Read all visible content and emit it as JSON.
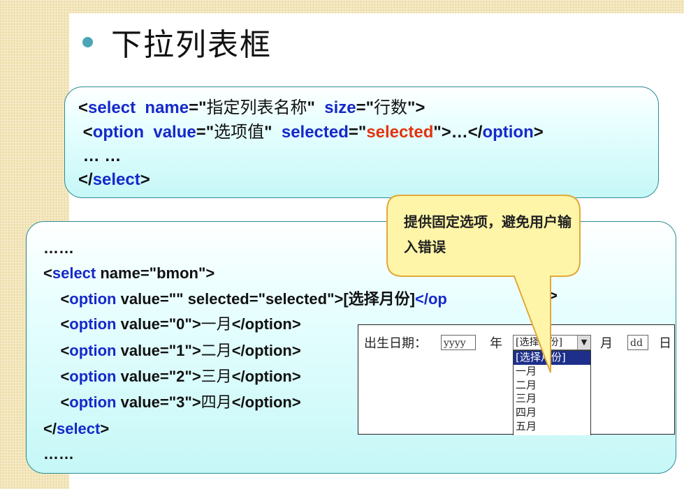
{
  "title": "下拉列表框",
  "syntax_box": {
    "l1": {
      "a": "<",
      "b": "select",
      "c": "  ",
      "d": "name",
      "e": "=\"",
      "f": "指定列表名称",
      "g": "\"  ",
      "h": "size",
      "i": "=\"",
      "j": "行数",
      "k": "\">"
    },
    "l2": {
      "a": " <",
      "b": "option",
      "c": "  ",
      "d": "value",
      "e": "=\"",
      "f": "选项值",
      "g": "\"  ",
      "h": "selected",
      "i": "=\"",
      "j": "selected",
      "k": "\">…</",
      "l": "option",
      "m": ">"
    },
    "l3": " … …",
    "l4": {
      "a": "</",
      "b": "select",
      "c": ">"
    }
  },
  "callout": {
    "text": "提供固定选项，避免用户输入错误"
  },
  "example_box": {
    "l1": "……",
    "l2": {
      "a": "<",
      "b": "select",
      "c": " name=\"bmon\">"
    },
    "l3": {
      "a": "    <",
      "b": "option",
      "c": " value=\"\" selected=\"selected\">",
      "d": "[选择月份]",
      "e": "</op"
    },
    "l3tail": ">",
    "l4": {
      "a": "    <",
      "b": "option",
      "c": " value=\"0\">",
      "d": "一月",
      "e": "</option>"
    },
    "l5": {
      "a": "    <",
      "b": "option",
      "c": " value=\"1\">",
      "d": "二月",
      "e": "</option>"
    },
    "l6": {
      "a": "    <",
      "b": "option",
      "c": " value=\"2\">",
      "d": "三月",
      "e": "</option>"
    },
    "l7": {
      "a": "    <",
      "b": "option",
      "c": " value=\"3\">",
      "d": "四月",
      "e": "</option>"
    },
    "l8": {
      "a": "</",
      "b": "select",
      "c": ">"
    },
    "l9": "……"
  },
  "form": {
    "birth_label": "出生日期：",
    "year_placeholder": "yyyy",
    "year_label": "年",
    "month_selected": "[选择月份]",
    "dropdown_arrow": "▼",
    "month_label": "月",
    "day_placeholder": "dd",
    "day_label": "日",
    "options": [
      "[选择月份]",
      "一月",
      "二月",
      "三月",
      "四月",
      "五月"
    ]
  },
  "colors": {
    "keyword": "#1529c9",
    "highlight": "#e2330f",
    "callout_fill": "#fff5a8",
    "box_border": "#2b8c8f"
  }
}
